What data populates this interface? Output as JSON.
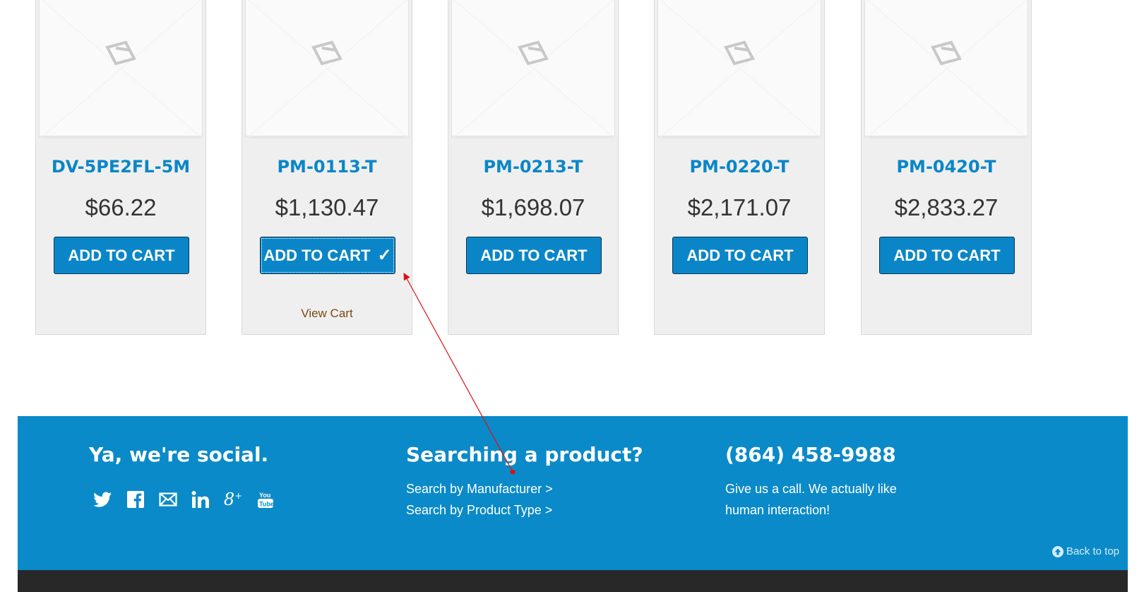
{
  "products": [
    {
      "sku": "DV-5PE2FL-5M",
      "price": "$66.22",
      "button": "ADD TO CART",
      "added": false,
      "view_cart": ""
    },
    {
      "sku": "PM-0113-T",
      "price": "$1,130.47",
      "button": "ADD TO CART",
      "added": true,
      "view_cart": "View Cart"
    },
    {
      "sku": "PM-0213-T",
      "price": "$1,698.07",
      "button": "ADD TO CART",
      "added": false,
      "view_cart": ""
    },
    {
      "sku": "PM-0220-T",
      "price": "$2,171.07",
      "button": "ADD TO CART",
      "added": false,
      "view_cart": ""
    },
    {
      "sku": "PM-0420-T",
      "price": "$2,833.27",
      "button": "ADD TO CART",
      "added": false,
      "view_cart": ""
    }
  ],
  "footer": {
    "social": {
      "title": "Ya, we're social.",
      "icons": [
        "twitter-icon",
        "facebook-icon",
        "email-icon",
        "linkedin-icon",
        "google-plus-icon",
        "youtube-icon"
      ]
    },
    "search": {
      "title": "Searching a product?",
      "by_manufacturer": "Search by Manufacturer >",
      "by_product_type": "Search by Product Type >"
    },
    "contact": {
      "phone": "(864) 458-9988",
      "line1": "Give us a call. We actually like",
      "line2": "human interaction!"
    },
    "back_to_top": "Back to top"
  },
  "colors": {
    "accent": "#0a86c8",
    "footer_bg": "#0a8ac8",
    "bottom_bar": "#282828",
    "annotation": "#e01010"
  }
}
